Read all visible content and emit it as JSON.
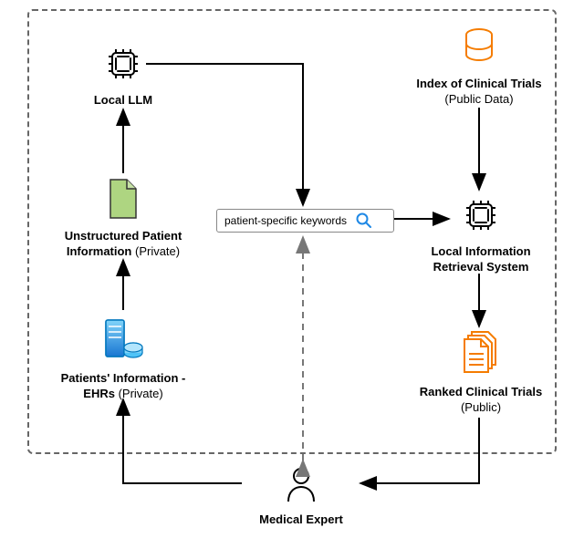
{
  "nodes": {
    "localLLM": {
      "title": "Local LLM"
    },
    "unstructured": {
      "title": "Unstructured Patient Information",
      "sub": " (Private)"
    },
    "ehr": {
      "title": "Patients' Information - EHRs",
      "sub": " (Private)"
    },
    "search": {
      "text": "patient-specific keywords"
    },
    "index": {
      "title": "Index of Clinical Trials",
      "sub": "(Public Data)"
    },
    "retrieval": {
      "title": "Local Information Retrieval System"
    },
    "ranked": {
      "title": "Ranked Clinical Trials",
      "sub": "(Public)"
    },
    "expert": {
      "title": "Medical Expert"
    }
  },
  "icons": {
    "chip": "chip-icon",
    "doc": "document-icon",
    "db": "database-icon",
    "server": "server-icon",
    "magnifier": "magnifier-icon",
    "docs": "documents-stack-icon",
    "person": "person-icon"
  },
  "colors": {
    "orange": "#f57c00",
    "blue": "#1e88e5",
    "green": "#aed581",
    "lightblue": "#4fc3f7"
  }
}
